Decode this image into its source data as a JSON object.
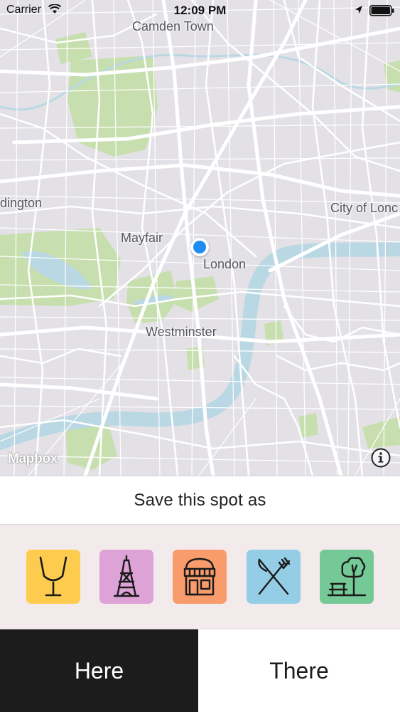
{
  "status_bar": {
    "carrier": "Carrier",
    "time": "12:09 PM",
    "icons": [
      "wifi-icon",
      "location-arrow-icon",
      "battery-icon"
    ]
  },
  "map": {
    "labels": {
      "camden": "Camden Town",
      "paddington": "dington",
      "city": "City of Lonc",
      "mayfair": "Mayfair",
      "london": "London",
      "westminster": "Westminster"
    },
    "attribution": "Mapbox",
    "info_icon": "info-icon",
    "colors": {
      "land": "#e3e1e6",
      "road": "#ffffff",
      "water": "#b9d8e4",
      "park": "#c7dfae",
      "user_location": "#1e8cf0"
    }
  },
  "save": {
    "title": "Save this spot as",
    "categories": [
      {
        "icon": "wine-glass-icon",
        "color": "#fdcc4e"
      },
      {
        "icon": "eiffel-tower-icon",
        "color": "#dda2d6"
      },
      {
        "icon": "shop-icon",
        "color": "#f99b6b"
      },
      {
        "icon": "knife-fork-icon",
        "color": "#93cde6"
      },
      {
        "icon": "park-bench-tree-icon",
        "color": "#74c997"
      }
    ]
  },
  "actions": {
    "here": "Here",
    "there": "There"
  }
}
